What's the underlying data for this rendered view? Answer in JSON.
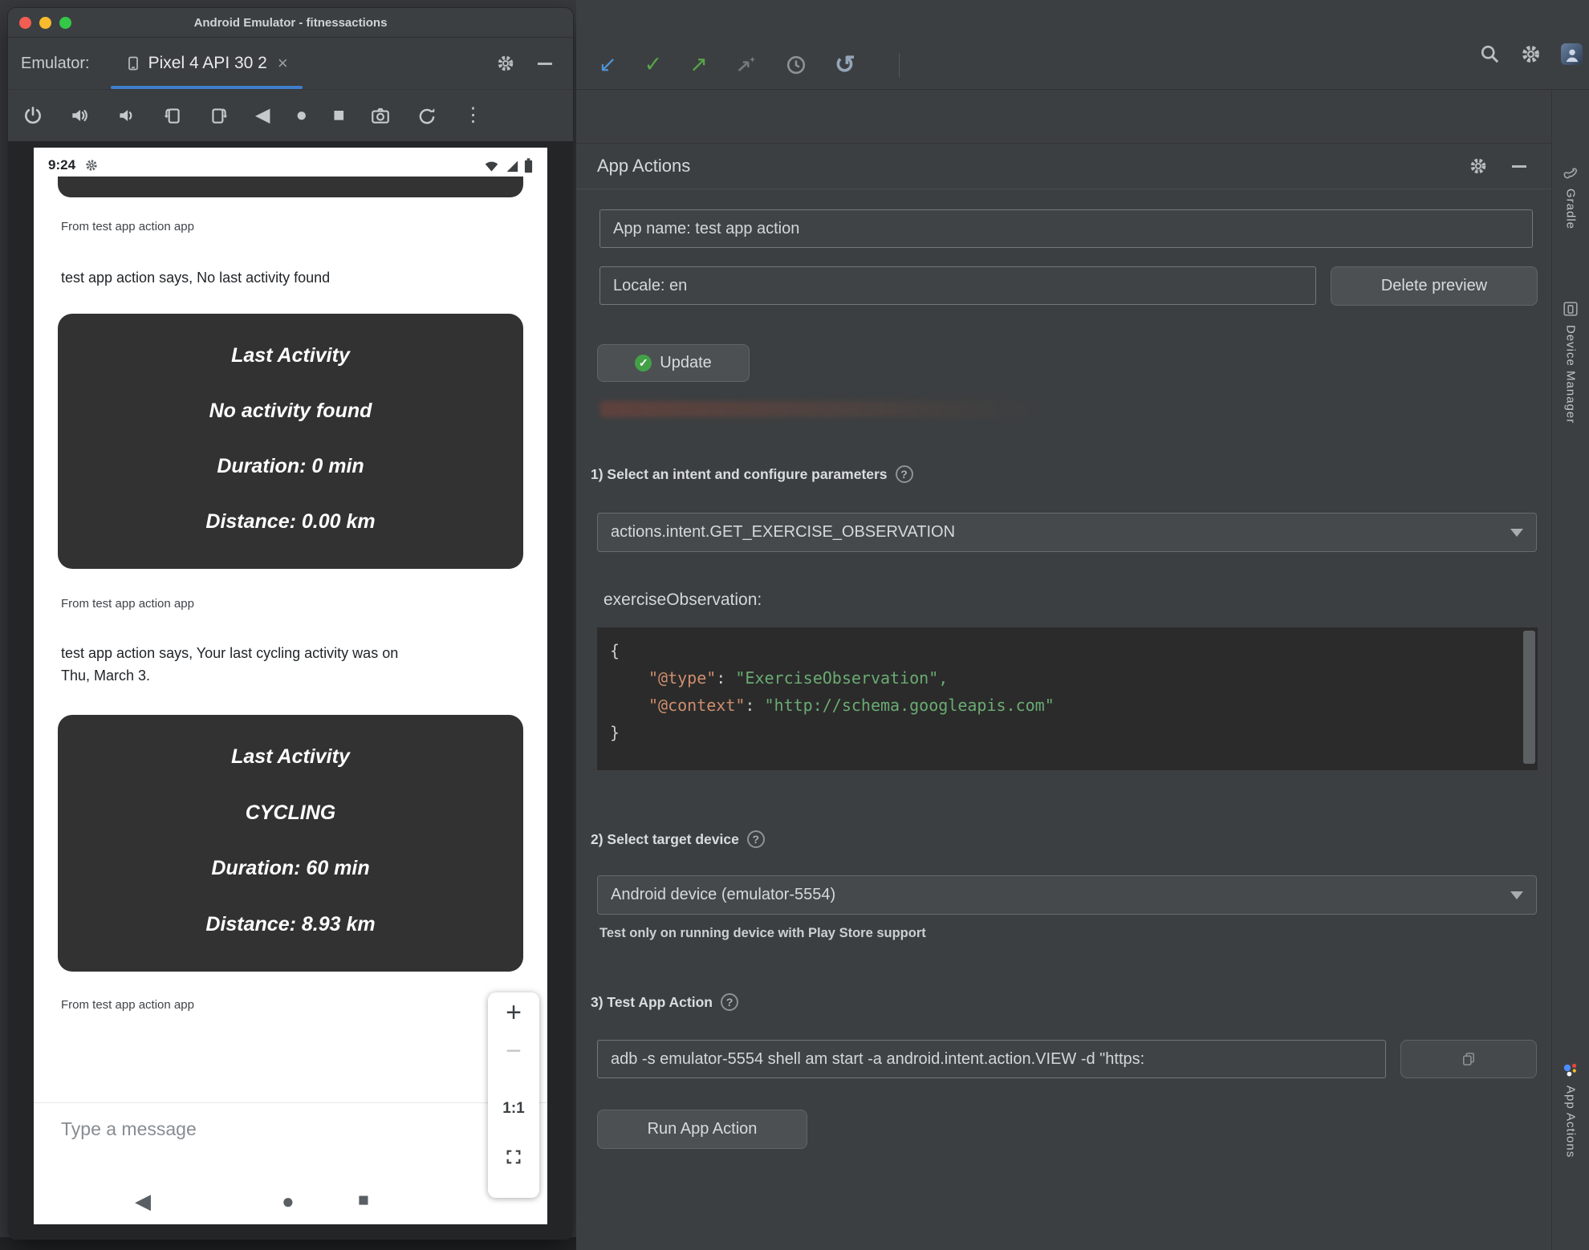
{
  "window": {
    "title": "Android Emulator - fitnessactions",
    "emulator_label": "Emulator:",
    "tab_label": "Pixel 4 API 30 2"
  },
  "icons": {
    "close_tab": "×",
    "more": "⋮",
    "back_nav": "◀",
    "home_nav": "●",
    "overview_nav": "■",
    "vcs_update": "↙",
    "vcs_commit": "✓",
    "vcs_push": "↗",
    "undo": "↺"
  },
  "phone": {
    "time": "9:24",
    "chat": {
      "from1": "From test app action app",
      "msg1": "test app action says, No last activity found",
      "card1": {
        "title": "Last Activity",
        "l1": "No activity found",
        "l2": "Duration: 0 min",
        "l3": "Distance: 0.00 km"
      },
      "from2": "From test app action app",
      "msg2": "test app action says, Your last cycling activity was on Thu, March 3.",
      "card2": {
        "title": "Last Activity",
        "l1": "CYCLING",
        "l2": "Duration: 60 min",
        "l3": "Distance: 8.93 km"
      },
      "from3": "From test app action app"
    },
    "zoom": {
      "plus": "+",
      "minus": "−",
      "ratio": "1:1"
    },
    "composer": "Type a message"
  },
  "ide": {
    "panel": {
      "title": "App Actions",
      "app_name": "App name: test app action",
      "locale": "Locale: en",
      "delete_preview_btn": "Delete preview",
      "update_btn": "Update",
      "sections": {
        "s1": "1) Select an intent and configure parameters",
        "s2": "2) Select target device",
        "s3": "3) Test App Action"
      },
      "help_glyph": "?",
      "intent": "actions.intent.GET_EXERCISE_OBSERVATION",
      "param_name": "exerciseObservation:",
      "code": {
        "open": "{",
        "k1": "\"@type\"",
        "sep": ": ",
        "v1": "\"ExerciseObservation\",",
        "k2": "\"@context\"",
        "v2": "\"http://schema.googleapis.com\"",
        "close": "}"
      },
      "device": "Android device (emulator-5554)",
      "device_hint": "Test only on running device with Play Store support",
      "adb_cmd": "adb -s emulator-5554 shell am start -a android.intent.action.VIEW -d \"https:",
      "run_btn": "Run App Action"
    },
    "sidebar": {
      "gradle": "Gradle",
      "device_manager": "Device Manager",
      "app_actions": "App Actions"
    }
  }
}
